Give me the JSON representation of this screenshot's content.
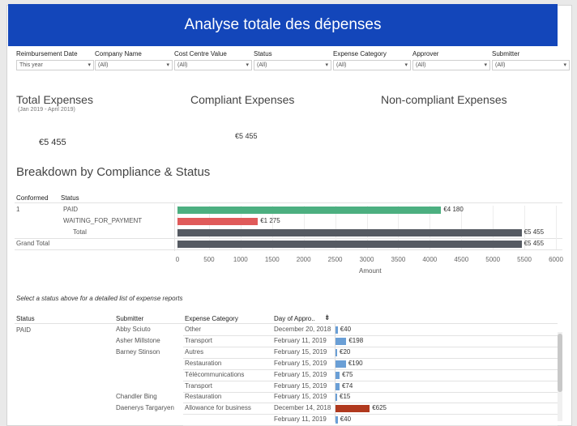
{
  "title": "Analyse totale des dépenses",
  "filters": [
    {
      "label": "Reimbursement Date",
      "value": "This year"
    },
    {
      "label": "Company Name",
      "value": "(All)"
    },
    {
      "label": "Cost Centre Value",
      "value": "(All)"
    },
    {
      "label": "Status",
      "value": "(All)"
    },
    {
      "label": "Expense Category",
      "value": "(All)"
    },
    {
      "label": "Approver",
      "value": "(All)"
    },
    {
      "label": "Submitter",
      "value": "(All)"
    }
  ],
  "kpis": {
    "total": {
      "title": "Total Expenses",
      "subtitle": "(Jan 2019 - April 2019)",
      "value": "€5 455"
    },
    "compliant": {
      "title": "Compliant Expenses",
      "value": "€5 455"
    },
    "noncompliant": {
      "title": "Non-compliant Expenses"
    }
  },
  "breakdown": {
    "title": "Breakdown by  Compliance & Status",
    "col_conformed": "Conformed",
    "col_status": "Status",
    "conformed_value": "1",
    "grand_total_label": "Grand Total",
    "axis_title": "Amount"
  },
  "chart_data": {
    "type": "bar",
    "orientation": "horizontal",
    "categories": [
      "PAID",
      "WAITING_FOR_PAYMENT",
      "Total",
      "Grand Total"
    ],
    "values": [
      4180,
      1275,
      5455,
      5455
    ],
    "labels": [
      "€4 180",
      "€1 275",
      "€5 455",
      "€5 455"
    ],
    "colors": [
      "#4caf80",
      "#e05a5a",
      "#555a62",
      "#555a62"
    ],
    "xlim": [
      0,
      6000
    ],
    "ticks": [
      "0",
      "500",
      "1000",
      "1500",
      "2000",
      "2500",
      "3000",
      "3500",
      "4000",
      "4500",
      "5000",
      "5500",
      "6000"
    ],
    "xlabel": "Amount"
  },
  "detail": {
    "hint": "Select a status above for a detailed list of expense reports",
    "headers": {
      "status": "Status",
      "submitter": "Submitter",
      "category": "Expense Category",
      "day": "Day of Appro.."
    },
    "status_value": "PAID",
    "rows": [
      {
        "submitter": "Abby Sciuto",
        "category": "Other",
        "date": "December 20, 2018",
        "amount": 40,
        "label": "€40",
        "color": "#6a9fd6"
      },
      {
        "submitter": "Asher Millstone",
        "category": "Transport",
        "date": "February 11, 2019",
        "amount": 198,
        "label": "€198",
        "color": "#6a9fd6"
      },
      {
        "submitter": "Barney Stinson",
        "category": "Autres",
        "date": "February 15, 2019",
        "amount": 20,
        "label": "€20",
        "color": "#6a9fd6"
      },
      {
        "submitter": "",
        "category": "Restauration",
        "date": "February 15, 2019",
        "amount": 190,
        "label": "€190",
        "color": "#6a9fd6"
      },
      {
        "submitter": "",
        "category": "Télécommunications",
        "date": "February 15, 2019",
        "amount": 75,
        "label": "€75",
        "color": "#6a9fd6"
      },
      {
        "submitter": "",
        "category": "Transport",
        "date": "February 15, 2019",
        "amount": 74,
        "label": "€74",
        "color": "#6a9fd6"
      },
      {
        "submitter": "Chandler Bing",
        "category": "Restauration",
        "date": "February 15, 2019",
        "amount": 15,
        "label": "€15",
        "color": "#6a9fd6"
      },
      {
        "submitter": "Daenerys Targaryen",
        "category": "Allowance for business",
        "date": "December 14, 2018",
        "amount": 625,
        "label": "€625",
        "color": "#b0391e"
      },
      {
        "submitter": "",
        "category": "",
        "date": "February 11, 2019",
        "amount": 40,
        "label": "€40",
        "color": "#6a9fd6"
      }
    ]
  }
}
